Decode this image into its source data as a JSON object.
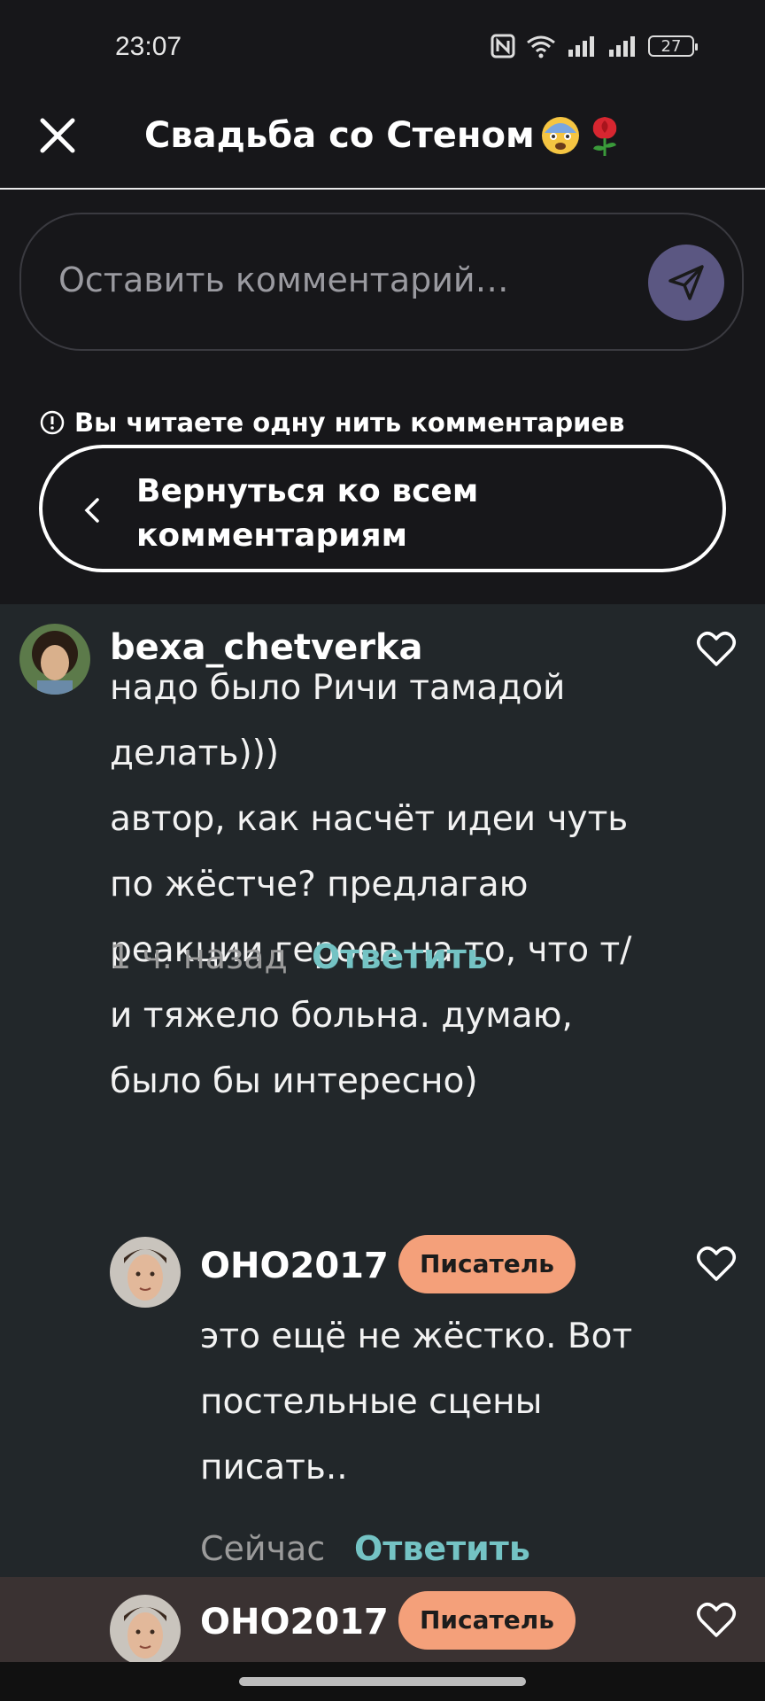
{
  "status": {
    "time": "23:07",
    "battery": "27"
  },
  "header": {
    "title": "Свадьба со Стеном",
    "close_icon": "close-icon"
  },
  "comment_input": {
    "placeholder": "Оставить комментарий…"
  },
  "thread": {
    "notice": "Вы читаете одну нить комментариев",
    "back_label": "Вернуться ко всем комментариям"
  },
  "comments": [
    {
      "username": "bexa_chetverka",
      "text": "надо было Ричи тамадой\nделать)))\nавтор, как насчёт идеи чуть\nпо жёстче? предлагаю\nреакции героев на то, что т/\nи тяжело больна. думаю,\nбыло бы интересно)",
      "time": "1 ч. назад",
      "reply": "Ответить"
    },
    {
      "username": "OHO2017",
      "badge": "Писатель",
      "text": "это ещё не жёстко. Вот\nпостельные сцены\nписать..",
      "time": "Сейчас",
      "reply": "Ответить"
    },
    {
      "username": "OHO2017",
      "badge": "Писатель"
    }
  ],
  "colors": {
    "background": "#17171a",
    "thread_background": "#22272a",
    "accent_link": "#74c3c4",
    "badge": "#f4a07a",
    "send_button": "#5b5782"
  }
}
